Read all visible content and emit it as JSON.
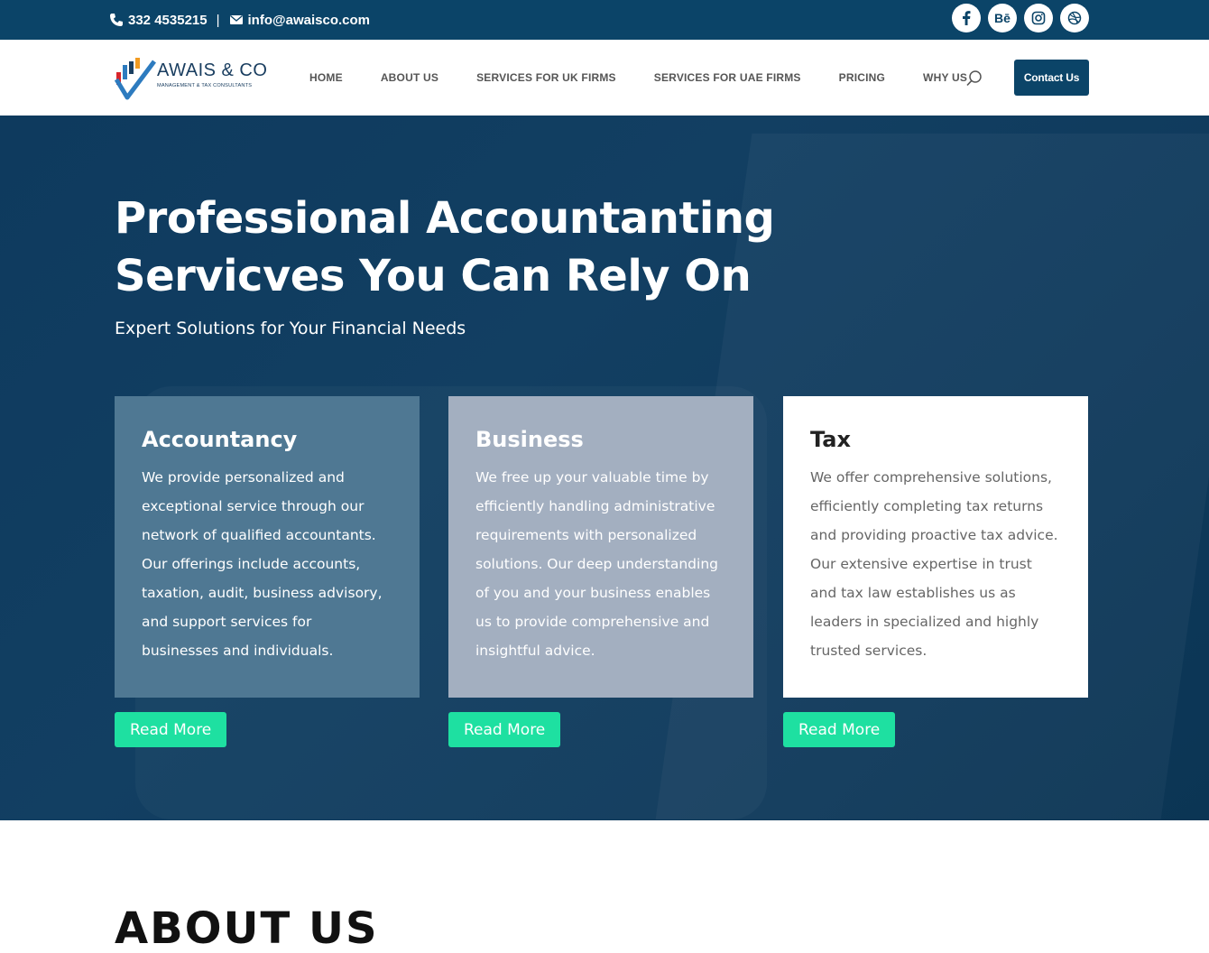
{
  "topbar": {
    "phone": "332 4535215",
    "separator": "|",
    "email": "info@awaisco.com",
    "social": [
      "facebook-icon",
      "behance-icon",
      "instagram-icon",
      "dribbble-icon"
    ],
    "behance_label": "Bē"
  },
  "nav": {
    "logo_name": "AWAIS & CO",
    "logo_tagline": "MANAGEMENT & TAX CONSULTANTS",
    "items": [
      {
        "label": "HOME"
      },
      {
        "label": "ABOUT US"
      },
      {
        "label": "SERVICES FOR UK FIRMS"
      },
      {
        "label": "SERVICES FOR UAE FIRMS"
      },
      {
        "label": "PRICING"
      },
      {
        "label": "WHY US"
      }
    ],
    "cta": "Contact Us"
  },
  "hero": {
    "title_line1": "Professional Accountanting",
    "title_line2": "Servicves You Can Rely On",
    "subtitle": "Expert Solutions for Your Financial Needs",
    "cards": [
      {
        "title": "Accountancy",
        "body": "We provide personalized and exceptional service through our network of qualified accountants. Our offerings include accounts, taxation, audit, business advisory, and support services for businesses and individuals.",
        "button": "Read More"
      },
      {
        "title": "Business",
        "body": "We free up your valuable time by efficiently handling administrative requirements with personalized solutions. Our deep understanding of you and your business enables us to provide comprehensive and insightful advice.",
        "button": "Read More"
      },
      {
        "title": "Tax",
        "body": "We offer comprehensive solutions, efficiently completing tax returns and providing proactive tax advice. Our extensive expertise in trust and tax law establishes us as leaders in specialized and highly trusted services.",
        "button": "Read More"
      }
    ]
  },
  "about": {
    "heading": "ABOUT US"
  },
  "colors": {
    "topbar": "#0b4468",
    "accent_button": "#1ee0a1",
    "card1": "#4f7893",
    "card2": "#a3afc0",
    "card3": "#ffffff"
  }
}
